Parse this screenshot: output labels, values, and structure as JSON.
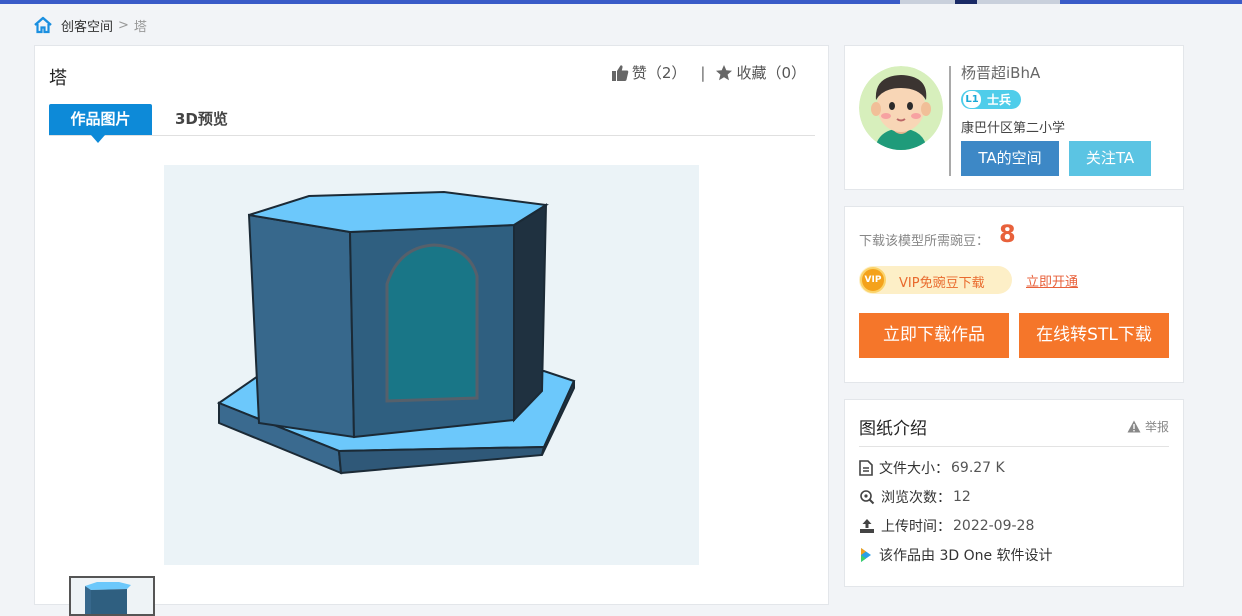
{
  "breadcrumb": {
    "home": "创客空间",
    "separator": ">",
    "current": "塔"
  },
  "work": {
    "title": "塔",
    "like_label": "赞（2）",
    "divider": "|",
    "fav_label": "收藏（0）",
    "tabs": [
      {
        "label": "作品图片",
        "active": true
      },
      {
        "label": "3D预览",
        "active": false
      }
    ]
  },
  "author": {
    "name": "杨晋超iBhA",
    "level_num": "L1",
    "level_rank": "士兵",
    "school": "康巴什区第二小学",
    "space_button": "TA的空间",
    "follow_button": "关注TA"
  },
  "download": {
    "label": "下载该模型所需豌豆：",
    "count": "8",
    "vip_badge": "VIP",
    "vip_text": "VIP免豌豆下载",
    "vip_link": "立即开通",
    "download_button": "立即下载作品",
    "stl_button": "在线转STL下载"
  },
  "info": {
    "title": "图纸介绍",
    "report": "举报",
    "rows": [
      {
        "label": "文件大小：",
        "value": "69.27 K",
        "icon": "file-icon"
      },
      {
        "label": "浏览次数：",
        "value": "12",
        "icon": "view-icon"
      },
      {
        "label": "上传时间：",
        "value": "2022-09-28",
        "icon": "upload-icon"
      },
      {
        "label": "该作品由 3D One 软件设计",
        "value": "",
        "icon": "3done-logo-icon"
      }
    ]
  },
  "colors": {
    "primary": "#0d8ad8",
    "orange": "#f5762a",
    "model_top": "#6cc8fb",
    "model_side": "#36607f"
  }
}
